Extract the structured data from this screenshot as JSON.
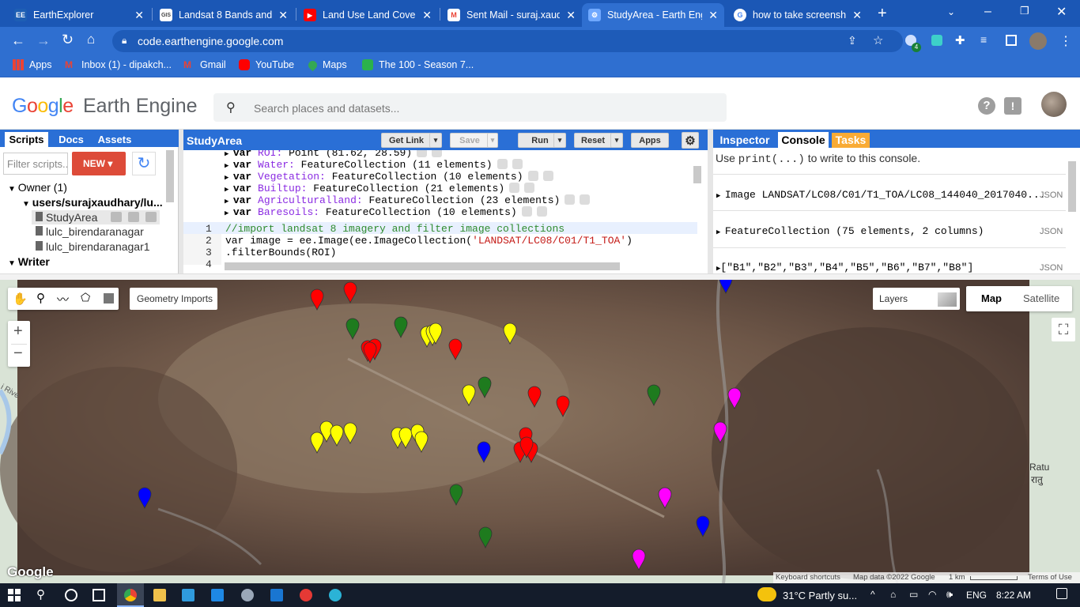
{
  "browser": {
    "tabs": [
      {
        "title": "EarthExplorer",
        "fav": "EE",
        "fav_color": "#1e5fb4"
      },
      {
        "title": "Landsat 8 Bands and B",
        "fav": "GIS",
        "fav_color": "#444"
      },
      {
        "title": "Land Use Land Cover",
        "fav": "▶",
        "fav_color": "#ff0000"
      },
      {
        "title": "Sent Mail - suraj.xaudh",
        "fav": "M",
        "fav_color": "#ea4335"
      },
      {
        "title": "StudyArea - Earth Eng",
        "fav": "⚙",
        "fav_color": "#4a90e2"
      },
      {
        "title": "how to take screensh",
        "fav": "G",
        "fav_color": "#4285f4"
      }
    ],
    "url": "code.earthengine.google.com",
    "bookmarks": [
      "Apps",
      "Inbox (1) - dipakch...",
      "Gmail",
      "YouTube",
      "Maps",
      "The 100 - Season 7..."
    ],
    "ext_badge": "4"
  },
  "gee": {
    "logo_google": "Google",
    "logo_ee": "Earth Engine",
    "search_placeholder": "Search places and datasets..."
  },
  "left_panel": {
    "tabs": [
      "Scripts",
      "Docs",
      "Assets"
    ],
    "filter_placeholder": "Filter scripts...",
    "new_label": "NEW",
    "owner_label": "Owner (1)",
    "repo_label": "users/surajxaudhary/lu...",
    "files": [
      "StudyArea",
      "lulc_birendaranagar",
      "lulc_birendaranagar1"
    ],
    "writer_label": "Writer"
  },
  "editor": {
    "title": "StudyArea",
    "buttons": {
      "get_link": "Get Link",
      "save": "Save",
      "run": "Run",
      "reset": "Reset",
      "apps": "Apps"
    },
    "imports": [
      {
        "kw": "var",
        "name": "ROI:",
        "type": "Point (81.62, 28.59)"
      },
      {
        "kw": "var",
        "name": "Water:",
        "type": "FeatureCollection (11 elements)"
      },
      {
        "kw": "var",
        "name": "Vegetation:",
        "type": "FeatureCollection (10 elements)"
      },
      {
        "kw": "var",
        "name": "Builtup:",
        "type": "FeatureCollection (21 elements)"
      },
      {
        "kw": "var",
        "name": "Agriculturalland:",
        "type": "FeatureCollection (23 elements)"
      },
      {
        "kw": "var",
        "name": "Baresoils:",
        "type": "FeatureCollection (10 elements)"
      }
    ],
    "line_numbers": [
      "1",
      "2",
      "3",
      "4"
    ],
    "code": {
      "line1": "//import landsat 8 imagery and filter image collections",
      "line2_a": "var image = ee.Image(ee.ImageCollection(",
      "line2_b": "'LANDSAT/LC08/C01/T1_TOA'",
      "line2_c": ")",
      "line3": ".filterBounds(ROI)"
    }
  },
  "right_panel": {
    "tabs": [
      "Inspector",
      "Console",
      "Tasks"
    ],
    "hint_a": "Use ",
    "hint_b": "print(...)",
    "hint_c": " to write to this console.",
    "entries": [
      {
        "text": "Image LANDSAT/LC08/C01/T1_TOA/LC08_144040_2017040...",
        "tag": "JSON"
      },
      {
        "text": "FeatureCollection (75 elements, 2 columns)",
        "tag": "JSON"
      },
      {
        "text": "[\"B1\",\"B2\",\"B3\",\"B4\",\"B5\",\"B6\",\"B7\",\"B8\"]",
        "tag": "JSON"
      }
    ]
  },
  "map": {
    "geometry_imports": "Geometry Imports",
    "layers": "Layers",
    "map_btn": "Map",
    "satellite_btn": "Satellite",
    "zoom_in": "+",
    "zoom_out": "−",
    "place_label_1": "Ratu",
    "place_label_2": "रातु",
    "river_label": "i Rive",
    "google_logo": "Google",
    "attribution": [
      "Keyboard shortcuts",
      "Map data ©2022 Google",
      "1 km",
      "Terms of Use"
    ],
    "colors": {
      "red": "#ff0000",
      "green": "#1e7b1e",
      "yellow": "#ffff00",
      "blue": "#0000ff",
      "magenta": "#ff00ff"
    }
  },
  "taskbar": {
    "weather": "31°C  Partly su...",
    "lang": "ENG",
    "time": "8:22 AM"
  }
}
